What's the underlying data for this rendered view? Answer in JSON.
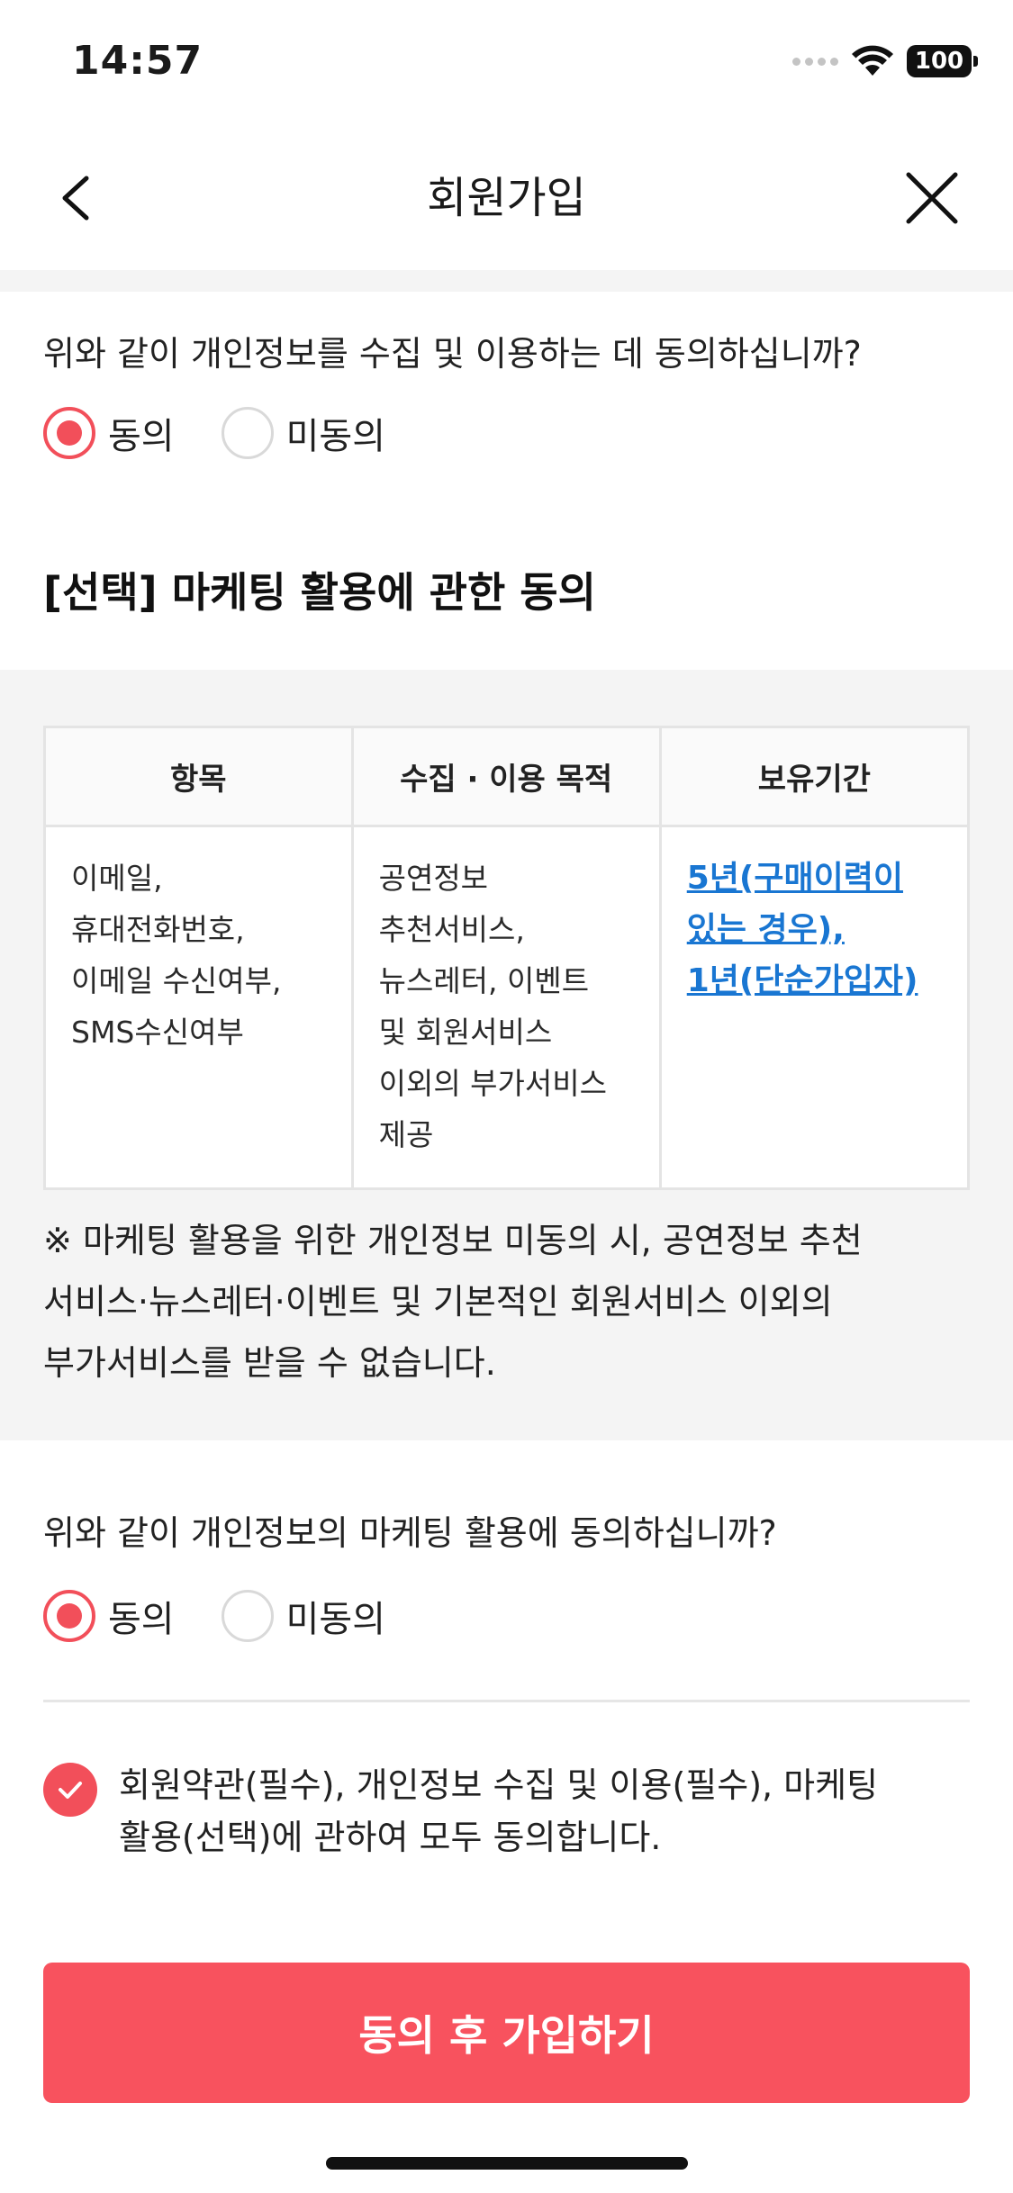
{
  "status_bar": {
    "time": "14:57",
    "battery": "100"
  },
  "nav": {
    "title": "회원가입",
    "back_icon": "chevron-left-icon",
    "close_icon": "close-icon"
  },
  "privacy_consent": {
    "question": "위와 같이 개인정보를 수집 및 이용하는 데 동의하십니까?",
    "options": [
      "동의",
      "미동의"
    ],
    "selected": "동의"
  },
  "marketing": {
    "title": "[선택] 마케팅 활용에 관한 동의",
    "table": {
      "headers": [
        "항목",
        "수집 · 이용 목적",
        "보유기간"
      ],
      "row": {
        "items": [
          "이메일,",
          "휴대전화번호,",
          "이메일 수신여부,",
          "SMS수신여부"
        ],
        "purpose": [
          "공연정보",
          "추천서비스,",
          "뉴스레터, 이벤트",
          "및 회원서비스",
          "이외의 부가서비스",
          "제공"
        ],
        "retention": [
          "5년(구매이력이",
          "있는 경우),",
          "1년(단순가입자)"
        ]
      }
    },
    "note": [
      "※ 마케팅 활용을 위한 개인정보 미동의 시, 공연정보 추천",
      "서비스·뉴스레터·이벤트 및 기본적인 회원서비스 이외의",
      "부가서비스를 받을 수 없습니다."
    ],
    "question": "위와 같이 개인정보의 마케팅 활용에 동의하십니까?",
    "options": [
      "동의",
      "미동의"
    ],
    "selected": "동의"
  },
  "all_agree": {
    "checked": true,
    "text": [
      "회원약관(필수), 개인정보 수집 및 이용(필수), 마케팅",
      "활용(선택)에 관하여 모두 동의합니다."
    ]
  },
  "cta": {
    "label": "동의 후 가입하기"
  },
  "colors": {
    "accent": "#f8525e",
    "link": "#1976d2",
    "section_bg": "#f4f4f4"
  }
}
